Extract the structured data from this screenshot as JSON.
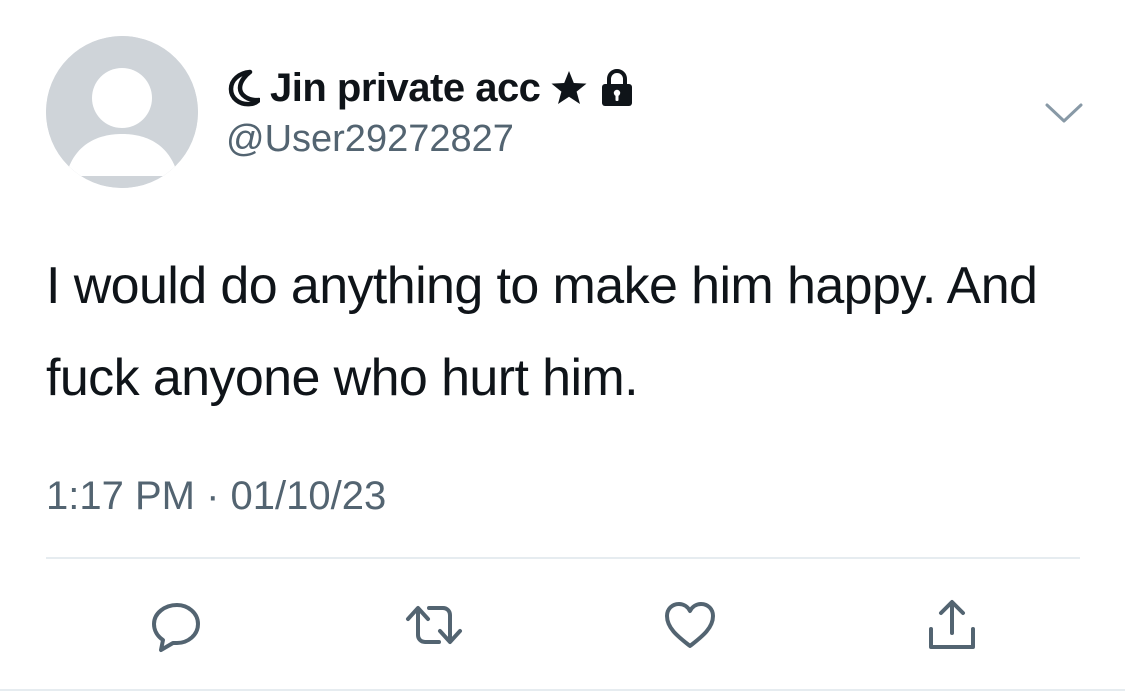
{
  "author": {
    "display_name": "Jin private acc",
    "handle": "@User29272827",
    "icons": [
      "crescent-moon-icon",
      "star-icon",
      "lock-icon",
      "default-avatar-icon"
    ]
  },
  "tweet": {
    "text": "I would do anything to make him happy. And fuck anyone who hurt him.",
    "time": "1:17 PM",
    "separator": "·",
    "date": "01/10/23"
  },
  "actions": [
    {
      "icon": "reply-icon"
    },
    {
      "icon": "retweet-icon"
    },
    {
      "icon": "like-icon"
    },
    {
      "icon": "share-icon"
    }
  ],
  "colors": {
    "text": "#0f1419",
    "secondary": "#536471",
    "avatar": "#cfd4d9",
    "divider": "#e6ecf0"
  }
}
